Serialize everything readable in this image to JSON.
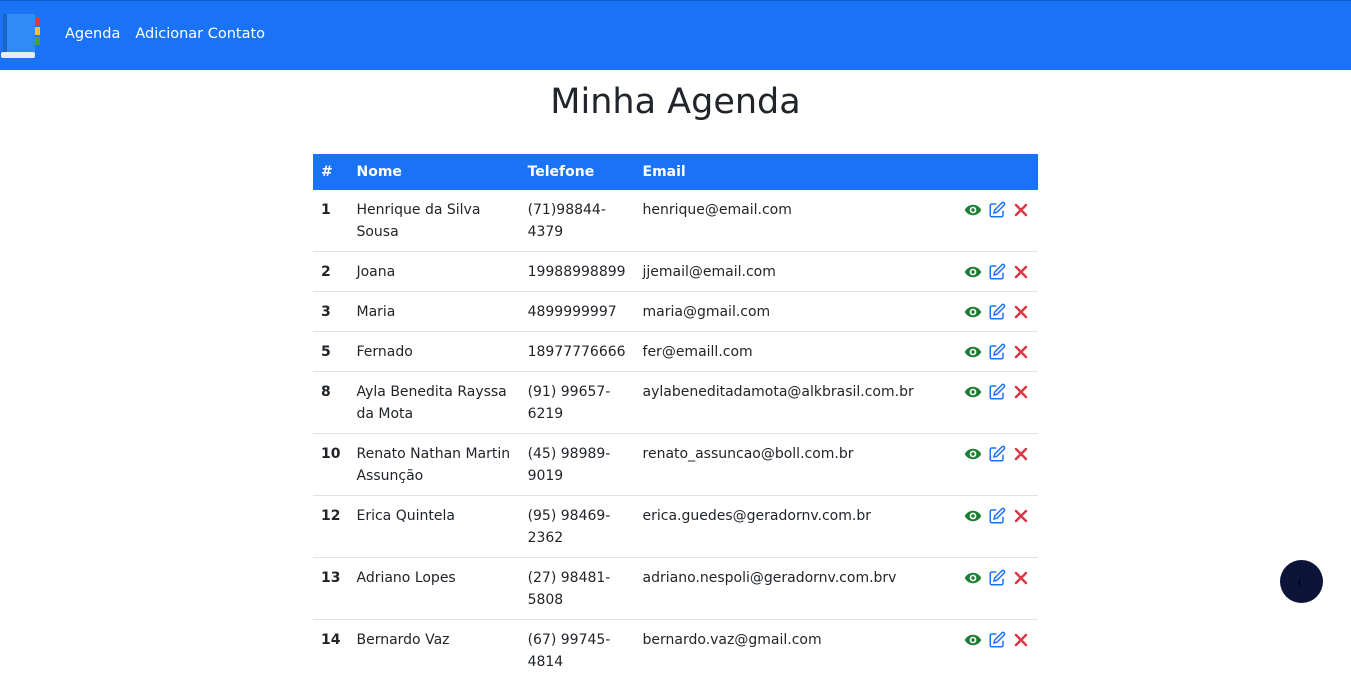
{
  "nav": {
    "logo_icon": "address-book-icon",
    "links": [
      "Agenda",
      "Adicionar Contato"
    ]
  },
  "page": {
    "title": "Minha Agenda"
  },
  "table": {
    "headers": [
      "#",
      "Nome",
      "Telefone",
      "Email"
    ],
    "rows": [
      {
        "id": "1",
        "name": "Henrique da Silva Sousa",
        "phone": "(71)98844-4379",
        "email": "henrique@email.com"
      },
      {
        "id": "2",
        "name": "Joana",
        "phone": "19988998899",
        "email": "jjemail@email.com"
      },
      {
        "id": "3",
        "name": "Maria",
        "phone": "4899999997",
        "email": "maria@gmail.com"
      },
      {
        "id": "5",
        "name": "Fernado",
        "phone": "18977776666",
        "email": "fer@emaill.com"
      },
      {
        "id": "8",
        "name": "Ayla Benedita Rayssa da Mota",
        "phone": "(91) 99657-6219",
        "email": "aylabeneditadamota@alkbrasil.com.br"
      },
      {
        "id": "10",
        "name": "Renato Nathan Martin Assunção",
        "phone": "(45) 98989-9019",
        "email": "renato_assuncao@boll.com.br"
      },
      {
        "id": "12",
        "name": "Erica Quintela",
        "phone": "(95) 98469-2362",
        "email": "erica.guedes@geradornv.com.br"
      },
      {
        "id": "13",
        "name": "Adriano Lopes",
        "phone": "(27) 98481-5808",
        "email": "adriano.nespoli@geradornv.com.brv"
      },
      {
        "id": "14",
        "name": "Bernardo Vaz",
        "phone": "(67) 99745-4814",
        "email": "bernardo.vaz@gmail.com"
      }
    ],
    "actions": [
      {
        "icon": "eye-icon",
        "color": "#1e7e34"
      },
      {
        "icon": "edit-icon",
        "color": "#1a73f5"
      },
      {
        "icon": "close-icon",
        "color": "#dc3545"
      }
    ]
  },
  "theme_toggle": {
    "icon": "moon-icon",
    "background": "#0c1538"
  },
  "colors": {
    "primary": "#1a73f5",
    "success": "#1e7e34",
    "danger": "#dc3545"
  }
}
